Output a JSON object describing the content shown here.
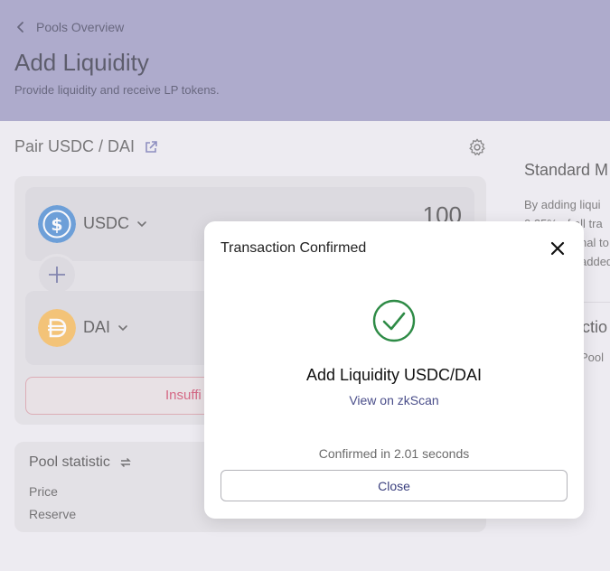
{
  "header": {
    "back_label": "Pools Overview",
    "title": "Add Liquidity",
    "subtitle": "Provide liquidity and receive LP tokens."
  },
  "pair": {
    "title": "Pair USDC / DAI"
  },
  "token_a": {
    "symbol": "USDC",
    "amount": "100",
    "icon": "usdc-icon",
    "color": "#2775ca"
  },
  "token_b": {
    "symbol": "DAI",
    "icon": "dai-icon",
    "color": "#f5ac37"
  },
  "action_button": {
    "label": "Insuffi"
  },
  "pool_statistic": {
    "title": "Pool statistic",
    "price_label": "Price",
    "reserve_label": "Reserve"
  },
  "side_panel": {
    "title": "Standard M",
    "line1": "By adding liqui",
    "line2": "0.25% of all tra",
    "line3": "nal to",
    "line4": "added",
    "title2": "ctio",
    "line5": "Pool"
  },
  "modal": {
    "title": "Transaction Confirmed",
    "heading": "Add Liquidity USDC/DAI",
    "link": "View on zkScan",
    "confirmed_text": "Confirmed in 2.01 seconds",
    "close_label": "Close",
    "success_color": "#2e8b46"
  }
}
